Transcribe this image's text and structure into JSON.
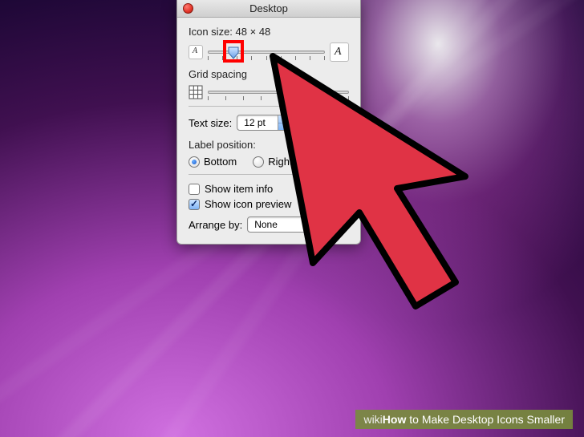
{
  "window": {
    "title": "Desktop"
  },
  "icon_size": {
    "label_prefix": "Icon size:",
    "value": "48 × 48",
    "slider_percent": 22
  },
  "grid_spacing": {
    "label": "Grid spacing",
    "slider_percent": 50
  },
  "text_size": {
    "label": "Text size:",
    "value": "12 pt"
  },
  "label_position": {
    "label": "Label position:",
    "options": {
      "bottom": "Bottom",
      "right": "Right"
    },
    "selected": "bottom"
  },
  "checks": {
    "show_item_info": {
      "label": "Show item info",
      "checked": false
    },
    "show_icon_preview": {
      "label": "Show icon preview",
      "checked": true
    }
  },
  "arrange_by": {
    "label": "Arrange by:",
    "value": "None"
  },
  "watermark": {
    "brand_a": "wiki",
    "brand_b": "How",
    "title": " to Make Desktop Icons Smaller"
  }
}
